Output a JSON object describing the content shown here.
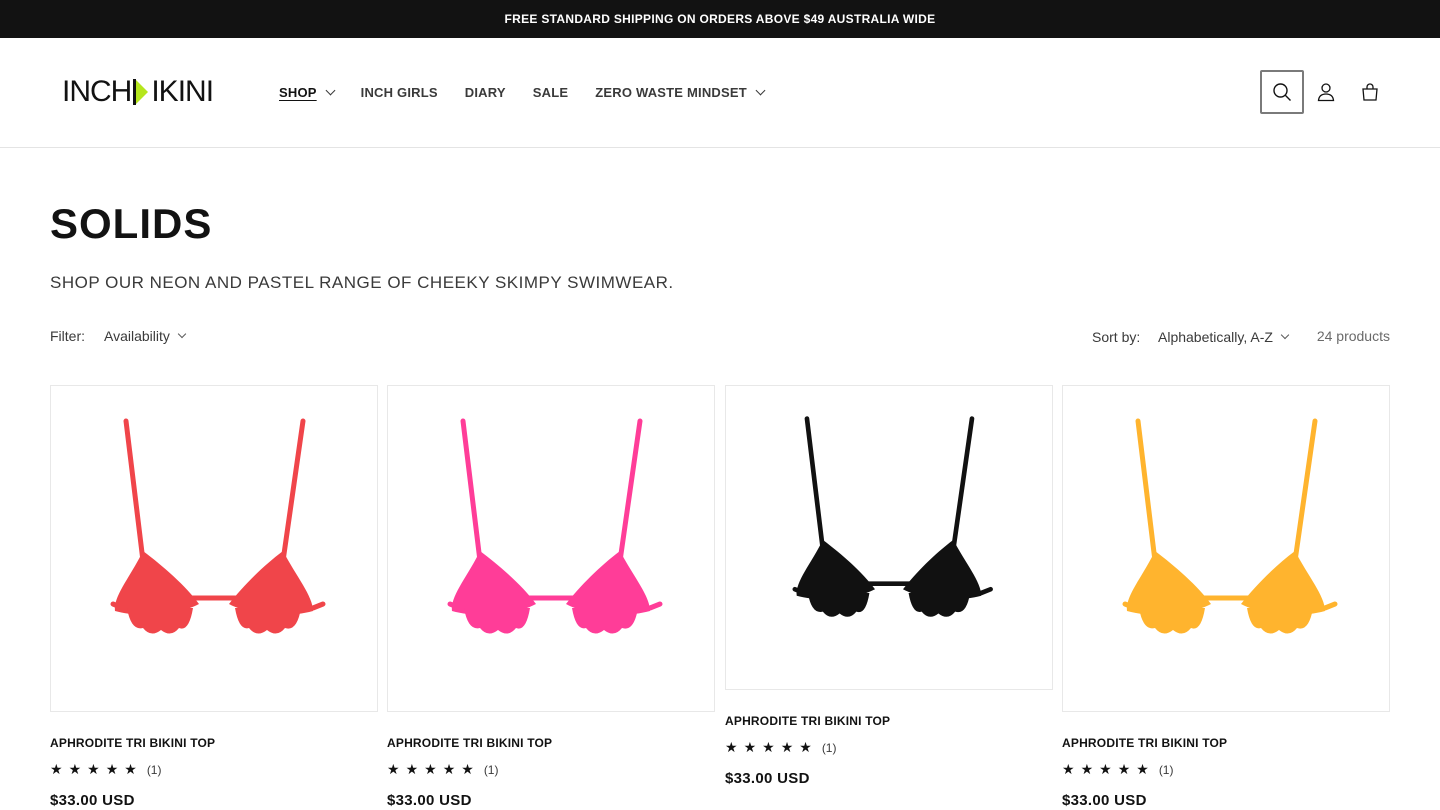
{
  "announcement": "FREE STANDARD SHIPPING ON ORDERS ABOVE $49 AUSTRALIA WIDE",
  "logo": {
    "text_left": "INCH",
    "text_right": "IKINI",
    "accent": "#b5e61d"
  },
  "nav": {
    "items": [
      {
        "label": "SHOP",
        "has_dropdown": true,
        "active": true
      },
      {
        "label": "INCH GIRLS",
        "has_dropdown": false
      },
      {
        "label": "DIARY",
        "has_dropdown": false
      },
      {
        "label": "SALE",
        "has_dropdown": false
      },
      {
        "label": "ZERO WASTE MINDSET",
        "has_dropdown": true
      }
    ]
  },
  "header_icons": [
    "search-icon",
    "account-icon",
    "cart-icon"
  ],
  "collection": {
    "title": "SOLIDS",
    "description": "SHOP OUR NEON AND PASTEL RANGE OF CHEEKY SKIMPY SWIMWEAR."
  },
  "filter": {
    "label": "Filter:",
    "availability": "Availability"
  },
  "sort": {
    "label": "Sort by:",
    "selected": "Alphabetically, A-Z"
  },
  "product_count": "24 products",
  "products": [
    {
      "name": "APHRODITE TRI BIKINI TOP",
      "rating": 5,
      "reviews": "(1)",
      "price": "$33.00 USD",
      "color": "#f0454a"
    },
    {
      "name": "APHRODITE TRI BIKINI TOP",
      "rating": 5,
      "reviews": "(1)",
      "price": "$33.00 USD",
      "color": "#ff3d98"
    },
    {
      "name": "APHRODITE TRI BIKINI TOP",
      "rating": 5,
      "reviews": "(1)",
      "price": "$33.00 USD",
      "color": "#111111"
    },
    {
      "name": "APHRODITE TRI BIKINI TOP",
      "rating": 5,
      "reviews": "(1)",
      "price": "$33.00 USD",
      "color": "#ffb42e"
    }
  ]
}
